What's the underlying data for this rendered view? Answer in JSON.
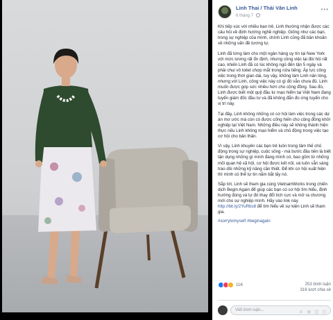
{
  "post": {
    "author": "Linh Thai / Thái Vân Linh",
    "time": "6 tháng 7",
    "more_icon": "more-options-icon",
    "paragraphs": [
      "Khi tiếp xúc với nhiều bạn trẻ, Linh thường nhận được các câu hỏi về định hướng nghề nghiệp. Giống như các bạn, trong sự nghiệp của mình, chính Linh cũng đã băn khoăn về những vấn đề tương tự.",
      "Linh đã từng làm cho một ngân hàng uy tín tại New York với mức lương rất ổn định, nhưng công việc lại đòi hỏi rất cao, khiến Linh đã có lúc không ngủ đến tận 5 ngày và phải chui vô toilet chợp mắt trong nửa tiếng. Áp lực công việc trong thời gian dài, tuy vậy, không làm Linh nản lòng, nhưng với Linh, công việc này có gì đó vẫn chưa đủ. Linh muốn được góp sức nhiều hơn cho cộng đồng. Sau đó, Linh được biết một quỹ đầu tư mạo hiểm tại Việt Nam đang tuyển giám đốc đầu tư và đã không đắn đo ứng tuyển cho vị trí này.",
      "Tại đây, Linh không những có cơ hội làm việc trong các dự án mơ ước mà còn có được cống hiến cho cộng đồng khởi nghiệp tại Việt Nam. Những điều này sẽ không thành hiện thực nếu Linh không mạo hiểm và chủ động trong việc tạo cơ hội cho bản thân.",
      "Vì vậy, Linh khuyên các bạn trẻ luôn trong tâm thế chủ động trong sự nghiệp, cuộc sống - mà bước đầu tiên là biết tận dụng những gì mình đang mình có, bao gồm từ những mối quan hệ xã hội, cơ hội được kết nối, và luôn sẵn sàng trao dồi những kỹ năng cần thiết. Để khi cơ hội xuất hiện thì mình có thể tự tin nắm bắt lấy nó."
    ],
    "last_paragraph_prefix": "Sắp tới, Linh sẽ tham gia cùng VietnamWorks trong chiến dịch Begin Again để giúp các bạn có cơ hội tìm hiểu, định hướng đúng và tự đó thay đổi tích cực và mở ra chương mới cho sự nghiệp mình. Hãy vào link này ",
    "last_paragraph_link": "http://bit.ly/2YuRbs8",
    "last_paragraph_suffix": " để tìm hiểu về sự kiện Linh sẽ tham gia.",
    "hashtags": "#sorrytomyself #beginagain",
    "reactions": {
      "count": "11K",
      "icons": [
        "like-reaction-icon",
        "love-reaction-icon",
        "haha-reaction-icon"
      ]
    },
    "comments_count": "253 bình luận",
    "shares_count": "316 lượt chia sẻ",
    "comment_placeholder": "Viết bình luận...",
    "comment_icons": "☺ ◎ ▢ ◻"
  },
  "colors": {
    "link": "#365899",
    "sweater": "#2e4a2f",
    "chair": "#b8b3ab"
  }
}
